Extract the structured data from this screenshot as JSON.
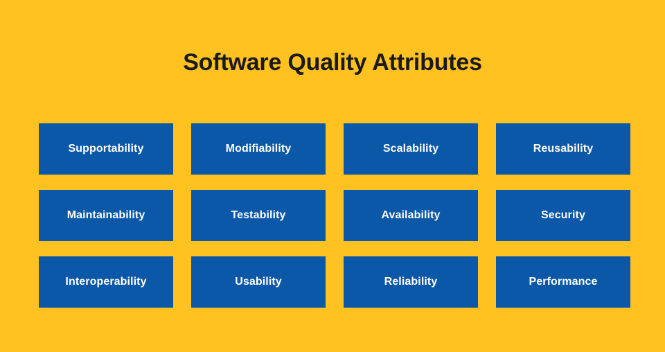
{
  "slide": {
    "title": "Software Quality Attributes",
    "background_color": "#FFC220",
    "title_color": "#1A1A1A",
    "box_color": "#0B57A8",
    "box_label_color": "#FFFFFF"
  },
  "grid": {
    "columns": 4,
    "rows": 3,
    "items": [
      {
        "label": "Supportability"
      },
      {
        "label": "Modifiability"
      },
      {
        "label": "Scalability"
      },
      {
        "label": "Reusability"
      },
      {
        "label": "Maintainability"
      },
      {
        "label": "Testability"
      },
      {
        "label": "Availability"
      },
      {
        "label": "Security"
      },
      {
        "label": "Interoperability"
      },
      {
        "label": "Usability"
      },
      {
        "label": "Reliability"
      },
      {
        "label": "Performance"
      }
    ]
  }
}
